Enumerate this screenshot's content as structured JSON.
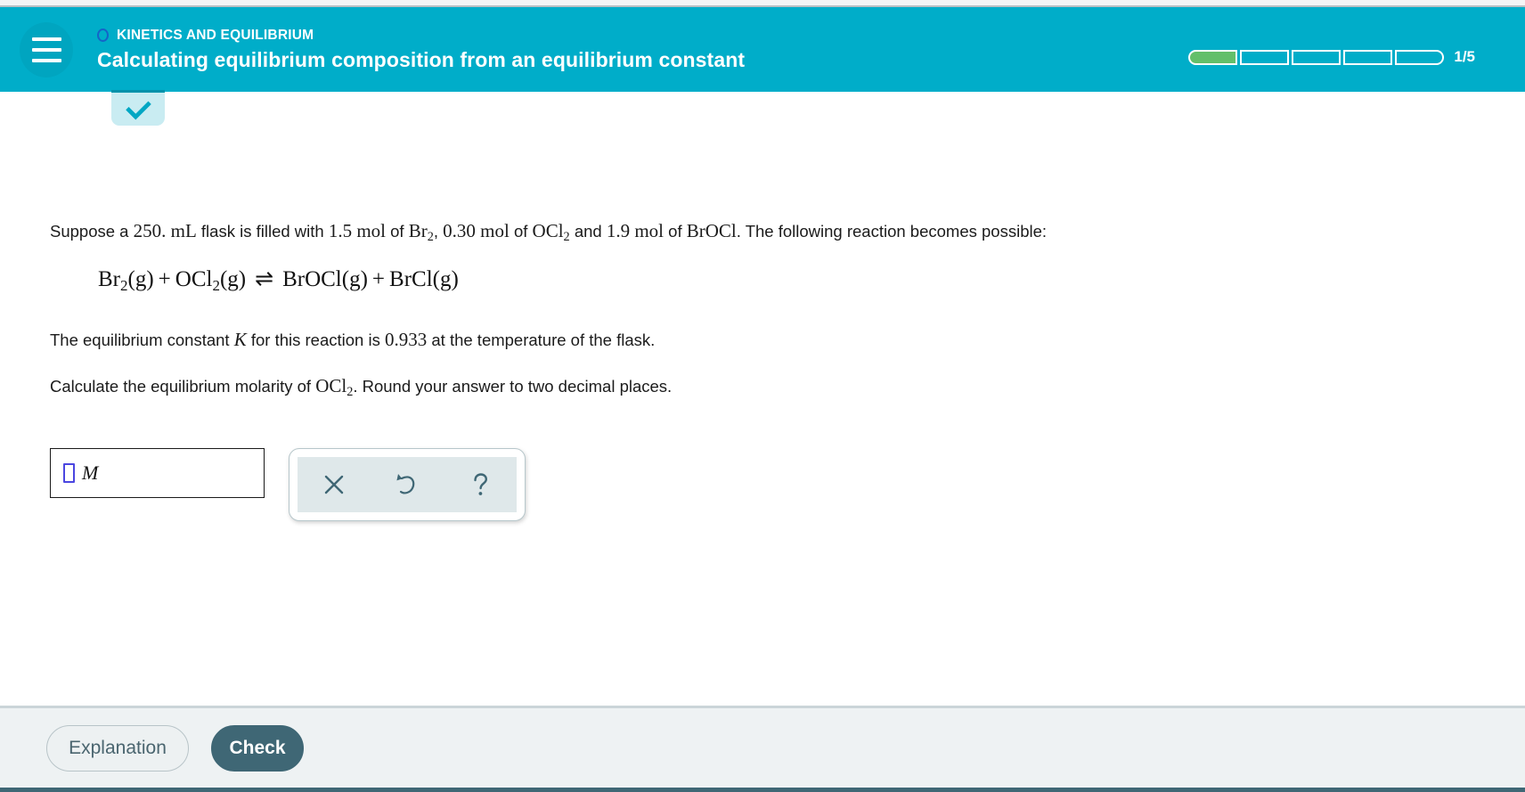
{
  "header": {
    "menu_icon": "hamburger-icon",
    "eyebrow_icon": "circle-outline-icon",
    "eyebrow": "KINETICS AND EQUILIBRIUM",
    "title": "Calculating equilibrium composition from an equilibrium constant",
    "progress": {
      "label": "1/5",
      "total_segments": 5,
      "filled_segments": 1,
      "fill_color": "#63bf6a",
      "track_color": "#ffffff"
    },
    "background_color": "#00adc9"
  },
  "collapse_tab": {
    "icon": "chevron-down-icon",
    "background_color": "#c9ecf2",
    "icon_color": "#00a7c4"
  },
  "question": {
    "intro": {
      "p1": "Suppose a ",
      "volume": "250. mL",
      "p2": " flask is filled with ",
      "amount1": "1.5 mol",
      "p3": " of ",
      "species1": "Br",
      "species1_sub": "2",
      "p4": ", ",
      "amount2": "0.30 mol",
      "p5": " of ",
      "species2": "OCl",
      "species2_sub": "2",
      "p6": " and ",
      "amount3": "1.9 mol",
      "p7": " of ",
      "species3": "BrOCl",
      "p8": ". The following reaction becomes possible:"
    },
    "equation": {
      "reactant1": "Br",
      "reactant1_sub": "2",
      "reactant1_state": "(g)",
      "plus1": "+",
      "reactant2": "OCl",
      "reactant2_sub": "2",
      "reactant2_state": "(g)",
      "arrow": "⇌",
      "product1": "BrOCl",
      "product1_state": "(g)",
      "plus2": "+",
      "product2": "BrCl",
      "product2_state": "(g)"
    },
    "constant_line": {
      "p1": "The equilibrium constant ",
      "symbol": "K",
      "p2": " for this reaction is ",
      "value": "0.933",
      "p3": " at the temperature of the flask."
    },
    "ask_line": {
      "p1": "Calculate the equilibrium molarity of ",
      "species": "OCl",
      "species_sub": "2",
      "p2": ". Round your answer to two decimal places."
    }
  },
  "answer": {
    "value": "",
    "placeholder": "",
    "unit": "M",
    "caret_color": "#4b46e0"
  },
  "tools": {
    "clear": {
      "icon": "close-x-icon",
      "label": "×"
    },
    "undo": {
      "icon": "undo-arrow-icon",
      "label": "↺"
    },
    "help": {
      "icon": "question-mark-icon",
      "label": "?"
    },
    "icon_color": "#3f6775",
    "panel_background": "#dfe8ea"
  },
  "footer": {
    "explanation_label": "Explanation",
    "check_label": "Check",
    "check_color": "#3f6775",
    "background_color": "#eef2f3"
  }
}
